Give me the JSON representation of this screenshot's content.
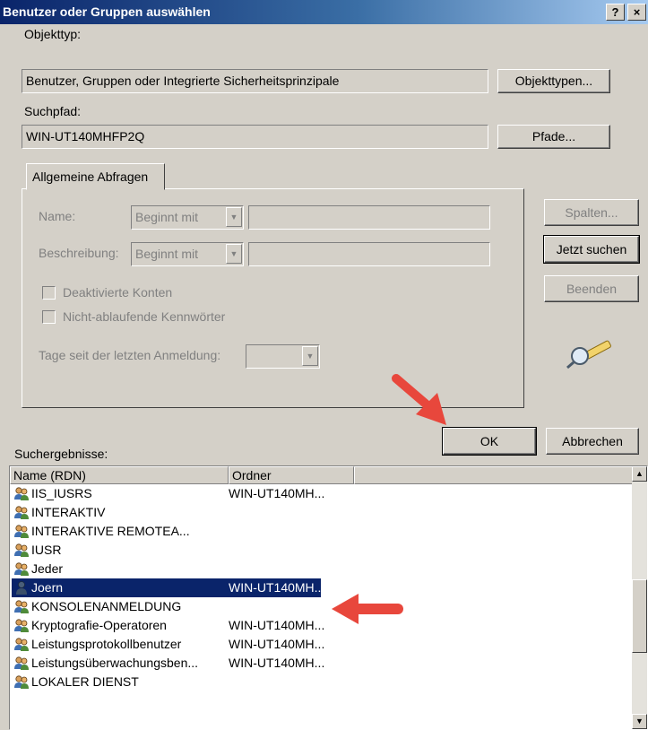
{
  "window": {
    "title": "Benutzer oder Gruppen auswählen",
    "help_btn": "?",
    "close_btn": "×"
  },
  "object_type": {
    "label": "Objekttyp:",
    "value": "Benutzer, Gruppen oder Integrierte Sicherheitsprinzipale",
    "button": "Objekttypen..."
  },
  "search_path": {
    "label": "Suchpfad:",
    "value": "WIN-UT140MHFP2Q",
    "button": "Pfade..."
  },
  "query": {
    "tab_label": "Allgemeine Abfragen",
    "name_label": "Name:",
    "name_mode": "Beginnt mit",
    "description_label": "Beschreibung:",
    "description_mode": "Beginnt mit",
    "disabled_accounts": "Deaktivierte Konten",
    "non_expiring_passwords": "Nicht-ablaufende Kennwörter",
    "days_since_login_label": "Tage seit der letzten Anmeldung:"
  },
  "side_buttons": {
    "columns": "Spalten...",
    "search_now": "Jetzt suchen",
    "stop": "Beenden"
  },
  "dialog_buttons": {
    "ok": "OK",
    "cancel": "Abbrechen"
  },
  "results": {
    "label": "Suchergebnisse:",
    "columns": [
      "Name (RDN)",
      "Ordner"
    ],
    "rows": [
      {
        "name": "IIS_IUSRS",
        "folder": "WIN-UT140MH...",
        "icon": "group-icon",
        "selected": false
      },
      {
        "name": "INTERAKTIV",
        "folder": "",
        "icon": "group-icon",
        "selected": false
      },
      {
        "name": "INTERAKTIVE REMOTEA...",
        "folder": "",
        "icon": "group-icon",
        "selected": false
      },
      {
        "name": "IUSR",
        "folder": "",
        "icon": "group-icon",
        "selected": false
      },
      {
        "name": "Jeder",
        "folder": "",
        "icon": "group-icon",
        "selected": false
      },
      {
        "name": "Joern",
        "folder": "WIN-UT140MH...",
        "icon": "user-icon",
        "selected": true
      },
      {
        "name": "KONSOLENANMELDUNG",
        "folder": "",
        "icon": "group-icon",
        "selected": false
      },
      {
        "name": "Kryptografie-Operatoren",
        "folder": "WIN-UT140MH...",
        "icon": "group-icon",
        "selected": false
      },
      {
        "name": "Leistungsprotokollbenutzer",
        "folder": "WIN-UT140MH...",
        "icon": "group-icon",
        "selected": false
      },
      {
        "name": "Leistungsüberwachungsben...",
        "folder": "WIN-UT140MH...",
        "icon": "group-icon",
        "selected": false
      },
      {
        "name": "LOKALER DIENST",
        "folder": "",
        "icon": "group-icon",
        "selected": false
      }
    ]
  },
  "colors": {
    "dialog_bg": "#d4d0c8",
    "title_start": "#0a246a",
    "selection": "#0a246a",
    "arrow": "#e8473c"
  }
}
